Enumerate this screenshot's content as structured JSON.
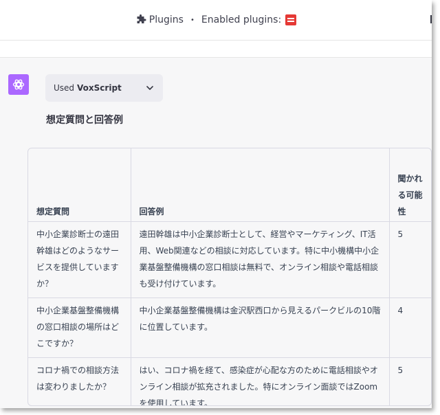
{
  "header": {
    "plugins_label": "Plugins",
    "separator": "•",
    "enabled_label": "Enabled plugins:",
    "plugin_icon": "voxscript-logo-icon"
  },
  "message": {
    "used_prefix": "Used",
    "plugin_name": "VoxScript",
    "heading": "想定質問と回答例"
  },
  "table": {
    "headers": [
      "想定質問",
      "回答例",
      "聞かれる可能性"
    ],
    "rows": [
      {
        "question": "中小企業診断士の遠田幹雄はどのようなサービスを提供していますか？",
        "answer": "遠田幹雄は中小企業診断士として、経営やマーケティング、IT活用、Web関連などの相談に対応しています。特に中小機構中小企業基盤整備機構の窓口相談は無料で、オンライン相談や電話相談も受け付けています。",
        "likelihood": "5"
      },
      {
        "question": "中小企業基盤整備機構の窓口相談の場所はどこですか？",
        "answer": "中小企業基盤整備機構は金沢駅西口から見えるパークビルの10階に位置しています。",
        "likelihood": "4"
      },
      {
        "question": "コロナ禍での相談方法は変わりましたか？",
        "answer": "はい、コロナ禍を経て、感染症が心配な方のために電話相談やオンライン相談が拡充されました。特にオンライン面談ではZoomを使用しています。",
        "likelihood": "5"
      }
    ]
  },
  "colors": {
    "avatar_bg": "#ab68ff",
    "content_bg": "#f7f7f8",
    "plugin_box_bg": "#ececf1"
  }
}
